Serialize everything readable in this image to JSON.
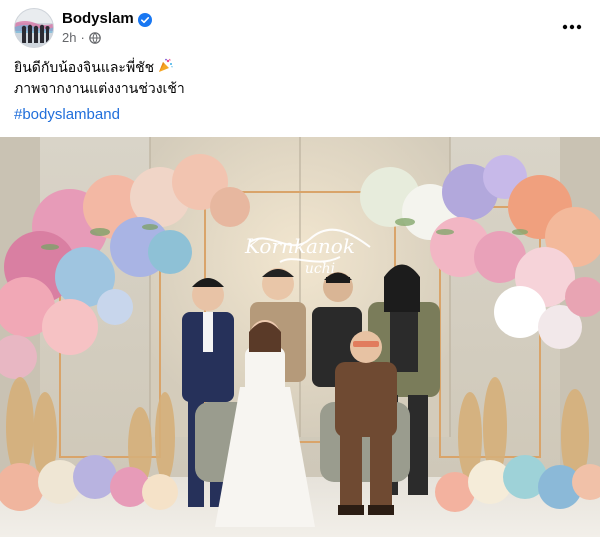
{
  "post": {
    "page_name": "Bodyslam",
    "time": "2h",
    "caption_line1": "ยินดีกับน้องจินและพี่ชัช",
    "caption_line2": "ภาพจากงานแต่งงานช่วงเช้า",
    "hashtag": "#bodyslamband",
    "icons": {
      "verified": "verified-badge-icon",
      "audience": "globe-icon",
      "menu": "more-horizontal-icon",
      "emoji": "party-popper-icon"
    },
    "photo": {
      "sign_line1": "Kornkanok",
      "sign_line2": "uchi"
    }
  },
  "colors": {
    "link": "#216fdb",
    "verified": "#1877f2",
    "secondary_text": "#65676b"
  }
}
